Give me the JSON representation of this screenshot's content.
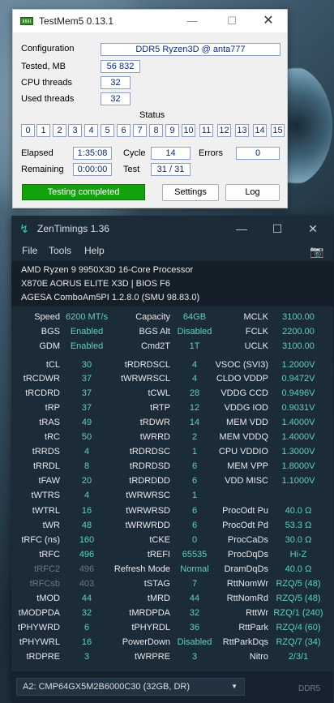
{
  "testmem": {
    "title": "TestMem5  0.13.1",
    "labels": {
      "configuration": "Configuration",
      "tested": "Tested, MB",
      "cpu_threads": "CPU threads",
      "used_threads": "Used threads",
      "status": "Status",
      "elapsed": "Elapsed",
      "remaining": "Remaining",
      "cycle": "Cycle",
      "test": "Test",
      "errors": "Errors"
    },
    "values": {
      "configuration": "DDR5 Ryzen3D @ anta777",
      "tested": "56 832",
      "cpu_threads": "32",
      "used_threads": "32",
      "elapsed": "1:35:08",
      "remaining": "0:00:00",
      "cycle": "14",
      "test": "31 / 31",
      "errors": "0"
    },
    "status_cells": [
      "0",
      "1",
      "2",
      "3",
      "4",
      "5",
      "6",
      "7",
      "8",
      "9",
      "10",
      "11",
      "12",
      "13",
      "14",
      "15"
    ],
    "progress_text": "Testing completed",
    "settings_label": "Settings",
    "log_label": "Log"
  },
  "zen": {
    "title": "ZenTimings 1.36",
    "menu": [
      "File",
      "Tools",
      "Help"
    ],
    "cpu": "AMD Ryzen 9 9950X3D 16-Core Processor",
    "board": "X870E AORUS ELITE X3D | BIOS F6",
    "agesa": "AGESA ComboAm5PI 1.2.8.0 (SMU 98.83.0)",
    "rows": [
      [
        [
          "Speed",
          "6200 MT/s"
        ],
        [
          "Capacity",
          "64GB"
        ],
        [
          "MCLK",
          "3100.00"
        ]
      ],
      [
        [
          "BGS",
          "Enabled"
        ],
        [
          "BGS Alt",
          "Disabled"
        ],
        [
          "FCLK",
          "2200.00"
        ]
      ],
      [
        [
          "GDM",
          "Enabled"
        ],
        [
          "Cmd2T",
          "1T"
        ],
        [
          "UCLK",
          "3100.00"
        ]
      ],
      [
        [
          "tCL",
          "30"
        ],
        [
          "tRDRDSCL",
          "4"
        ],
        [
          "VSOC (SVI3)",
          "1.2000V"
        ]
      ],
      [
        [
          "tRCDWR",
          "37"
        ],
        [
          "tWRWRSCL",
          "4"
        ],
        [
          "CLDO VDDP",
          "0.9472V"
        ]
      ],
      [
        [
          "tRCDRD",
          "37"
        ],
        [
          "tCWL",
          "28"
        ],
        [
          "VDDG CCD",
          "0.9496V"
        ]
      ],
      [
        [
          "tRP",
          "37"
        ],
        [
          "tRTP",
          "12"
        ],
        [
          "VDDG IOD",
          "0.9031V"
        ]
      ],
      [
        [
          "tRAS",
          "49"
        ],
        [
          "tRDWR",
          "14"
        ],
        [
          "MEM VDD",
          "1.4000V"
        ]
      ],
      [
        [
          "tRC",
          "50"
        ],
        [
          "tWRRD",
          "2"
        ],
        [
          "MEM VDDQ",
          "1.4000V"
        ]
      ],
      [
        [
          "tRRDS",
          "4"
        ],
        [
          "tRDRDSC",
          "1"
        ],
        [
          "CPU VDDIO",
          "1.3000V"
        ]
      ],
      [
        [
          "tRRDL",
          "8"
        ],
        [
          "tRDRDSD",
          "6"
        ],
        [
          "MEM VPP",
          "1.8000V"
        ]
      ],
      [
        [
          "tFAW",
          "20"
        ],
        [
          "tRDRDDD",
          "6"
        ],
        [
          "VDD MISC",
          "1.1000V"
        ]
      ],
      [
        [
          "tWTRS",
          "4"
        ],
        [
          "tWRWRSC",
          "1"
        ],
        [
          "",
          ""
        ]
      ],
      [
        [
          "tWTRL",
          "16"
        ],
        [
          "tWRWRSD",
          "6"
        ],
        [
          "ProcOdt Pu",
          "40.0 Ω"
        ]
      ],
      [
        [
          "tWR",
          "48"
        ],
        [
          "tWRWRDD",
          "6"
        ],
        [
          "ProcOdt Pd",
          "53.3 Ω"
        ]
      ],
      [
        [
          "tRFC (ns)",
          "160"
        ],
        [
          "tCKE",
          "0"
        ],
        [
          "ProcCaDs",
          "30.0 Ω"
        ]
      ],
      [
        [
          "tRFC",
          "496"
        ],
        [
          "tREFI",
          "65535"
        ],
        [
          "ProcDqDs",
          "Hi-Z"
        ]
      ],
      [
        [
          "tRFC2",
          "496"
        ],
        [
          "Refresh Mode",
          "Normal"
        ],
        [
          "DramDqDs",
          "40.0 Ω"
        ]
      ],
      [
        [
          "tRFCsb",
          "403"
        ],
        [
          "tSTAG",
          "7"
        ],
        [
          "RttNomWr",
          "RZQ/5 (48)"
        ]
      ],
      [
        [
          "tMOD",
          "44"
        ],
        [
          "tMRD",
          "44"
        ],
        [
          "RttNomRd",
          "RZQ/5 (48)"
        ]
      ],
      [
        [
          "tMODPDA",
          "32"
        ],
        [
          "tMRDPDA",
          "32"
        ],
        [
          "RttWr",
          "RZQ/1 (240)"
        ]
      ],
      [
        [
          "tPHYWRD",
          "6"
        ],
        [
          "tPHYRDL",
          "36"
        ],
        [
          "RttPark",
          "RZQ/4 (60)"
        ]
      ],
      [
        [
          "tPHYWRL",
          "16"
        ],
        [
          "PowerDown",
          "Disabled"
        ],
        [
          "RttParkDqs",
          "RZQ/7 (34)"
        ]
      ],
      [
        [
          "tRDPRE",
          "3"
        ],
        [
          "tWRPRE",
          "3"
        ],
        [
          "Nitro",
          "2/3/1"
        ]
      ]
    ],
    "dimm_select": "A2: CMP64GX5M2B6000C30 (32GB, DR)",
    "mem_type": "DDR5"
  }
}
